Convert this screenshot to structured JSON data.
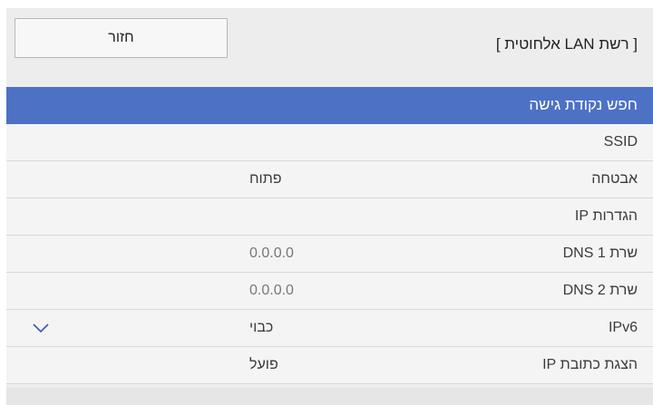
{
  "header": {
    "title": "[ רשת LAN אלחוטית ]",
    "back_label": "חזור"
  },
  "menu": {
    "items": [
      {
        "label": "חפש נקודת גישה",
        "value": ""
      },
      {
        "label": "SSID",
        "value": ""
      },
      {
        "label": "אבטחה",
        "value": "פתוח"
      },
      {
        "label": "הגדרות IP",
        "value": ""
      },
      {
        "label": "שרת DNS 1",
        "value": "0.0.0.0"
      },
      {
        "label": "שרת DNS 2",
        "value": "0.0.0.0"
      },
      {
        "label": "IPv6",
        "value": "כבוי"
      },
      {
        "label": "הצגת כתובת IP",
        "value": "פועל"
      }
    ]
  },
  "colors": {
    "highlight": "#4d71c4",
    "chevron": "#3a5ab0"
  },
  "icons": {
    "ipv6_dropdown": "chevron-down-icon"
  }
}
